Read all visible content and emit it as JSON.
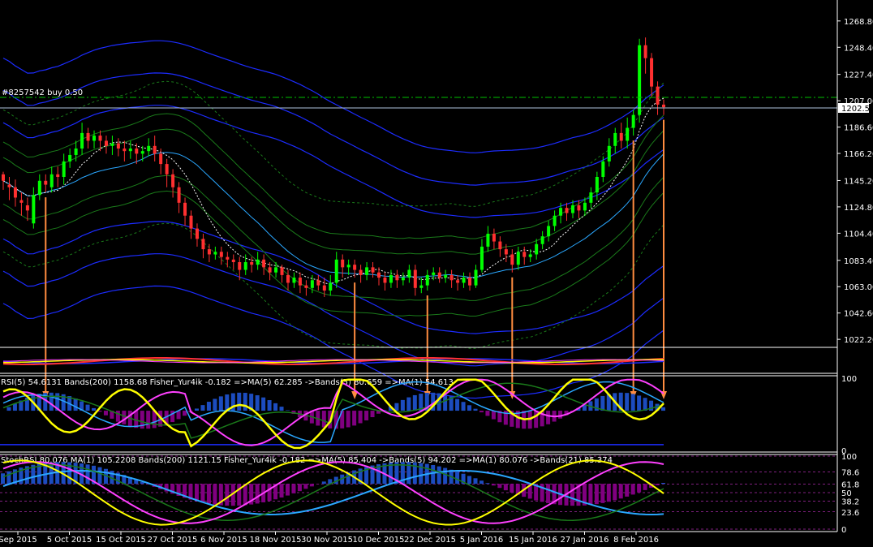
{
  "window": {
    "order_label": "#8257542 buy 0.50",
    "current_price": "1202.53"
  },
  "colors": {
    "background": "#000000",
    "bull_candle": "#00ff00",
    "bear_candle": "#ff3030",
    "arrow_orange": "#ff8c40",
    "band_blue": "#1c2cff",
    "band_cyan": "#2aa7ff",
    "band_green": "#1a7a1a",
    "yellow": "#ffff00",
    "magenta": "#ff40ff",
    "purple": "#800080",
    "grid_white": "#ffffff"
  },
  "chart_data": {
    "type": "line",
    "price_axis": {
      "ticks": [
        "1268.80",
        "1248.40",
        "1227.40",
        "1207.00",
        "1186.60",
        "1166.20",
        "1145.20",
        "1124.80",
        "1104.40",
        "1083.40",
        "1063.00",
        "1042.60",
        "1022.20"
      ],
      "ylim": [
        1016,
        1280
      ]
    },
    "x_ticks": [
      "Sep 2015",
      "5 Oct 2015",
      "15 Oct 2015",
      "27 Oct 2015",
      "6 Nov 2015",
      "18 Nov 2015",
      "30 Nov 2015",
      "10 Dec 2015",
      "22 Dec 2015",
      "5 Jan 2016",
      "15 Jan 2016",
      "27 Jan 2016",
      "8 Feb 2016"
    ],
    "candles": [
      [
        1150,
        1145,
        1138,
        1152
      ],
      [
        1142,
        1140,
        1130,
        1148
      ],
      [
        1140,
        1132,
        1125,
        1146
      ],
      [
        1130,
        1128,
        1118,
        1136
      ],
      [
        1126,
        1122,
        1114,
        1132
      ],
      [
        1112,
        1134,
        1108,
        1140
      ],
      [
        1134,
        1145,
        1130,
        1150
      ],
      [
        1145,
        1142,
        1136,
        1150
      ],
      [
        1140,
        1150,
        1136,
        1156
      ],
      [
        1150,
        1148,
        1140,
        1156
      ],
      [
        1148,
        1160,
        1142,
        1166
      ],
      [
        1160,
        1165,
        1155,
        1170
      ],
      [
        1165,
        1170,
        1160,
        1176
      ],
      [
        1170,
        1182,
        1165,
        1190
      ],
      [
        1182,
        1176,
        1170,
        1186
      ],
      [
        1176,
        1180,
        1170,
        1184
      ],
      [
        1180,
        1176,
        1168,
        1184
      ],
      [
        1176,
        1172,
        1166,
        1180
      ],
      [
        1172,
        1174,
        1165,
        1180
      ],
      [
        1174,
        1170,
        1164,
        1178
      ],
      [
        1170,
        1168,
        1160,
        1176
      ],
      [
        1168,
        1170,
        1162,
        1176
      ],
      [
        1170,
        1166,
        1158,
        1174
      ],
      [
        1166,
        1168,
        1160,
        1172
      ],
      [
        1168,
        1172,
        1164,
        1178
      ],
      [
        1172,
        1166,
        1160,
        1180
      ],
      [
        1166,
        1158,
        1150,
        1170
      ],
      [
        1158,
        1150,
        1140,
        1162
      ],
      [
        1150,
        1140,
        1132,
        1154
      ],
      [
        1140,
        1128,
        1120,
        1144
      ],
      [
        1128,
        1118,
        1110,
        1132
      ],
      [
        1118,
        1108,
        1100,
        1122
      ],
      [
        1108,
        1100,
        1094,
        1112
      ],
      [
        1100,
        1092,
        1085,
        1104
      ],
      [
        1092,
        1088,
        1082,
        1096
      ],
      [
        1088,
        1090,
        1084,
        1094
      ],
      [
        1090,
        1086,
        1080,
        1094
      ],
      [
        1086,
        1084,
        1078,
        1090
      ],
      [
        1084,
        1082,
        1076,
        1088
      ],
      [
        1082,
        1076,
        1068,
        1086
      ],
      [
        1076,
        1082,
        1072,
        1088
      ],
      [
        1082,
        1080,
        1074,
        1086
      ],
      [
        1080,
        1084,
        1076,
        1090
      ],
      [
        1084,
        1078,
        1072,
        1088
      ],
      [
        1078,
        1074,
        1068,
        1082
      ],
      [
        1074,
        1078,
        1070,
        1082
      ],
      [
        1078,
        1072,
        1066,
        1080
      ],
      [
        1072,
        1066,
        1060,
        1076
      ],
      [
        1066,
        1070,
        1062,
        1074
      ],
      [
        1070,
        1064,
        1058,
        1074
      ],
      [
        1064,
        1062,
        1056,
        1068
      ],
      [
        1062,
        1068,
        1058,
        1072
      ],
      [
        1068,
        1064,
        1060,
        1072
      ],
      [
        1064,
        1060,
        1055,
        1070
      ],
      [
        1060,
        1066,
        1056,
        1072
      ],
      [
        1066,
        1084,
        1062,
        1090
      ],
      [
        1084,
        1078,
        1070,
        1088
      ],
      [
        1078,
        1080,
        1072,
        1084
      ],
      [
        1080,
        1076,
        1070,
        1084
      ],
      [
        1076,
        1072,
        1066,
        1080
      ],
      [
        1072,
        1078,
        1068,
        1082
      ],
      [
        1078,
        1074,
        1070,
        1082
      ],
      [
        1074,
        1070,
        1064,
        1078
      ],
      [
        1070,
        1066,
        1060,
        1074
      ],
      [
        1066,
        1072,
        1062,
        1076
      ],
      [
        1072,
        1068,
        1062,
        1076
      ],
      [
        1068,
        1070,
        1064,
        1074
      ],
      [
        1070,
        1076,
        1066,
        1080
      ],
      [
        1076,
        1062,
        1056,
        1080
      ],
      [
        1062,
        1064,
        1058,
        1070
      ],
      [
        1064,
        1072,
        1060,
        1076
      ],
      [
        1072,
        1074,
        1068,
        1078
      ],
      [
        1074,
        1070,
        1066,
        1078
      ],
      [
        1070,
        1072,
        1066,
        1076
      ],
      [
        1072,
        1068,
        1062,
        1076
      ],
      [
        1068,
        1066,
        1060,
        1072
      ],
      [
        1066,
        1070,
        1062,
        1074
      ],
      [
        1070,
        1064,
        1060,
        1074
      ],
      [
        1064,
        1076,
        1062,
        1080
      ],
      [
        1076,
        1094,
        1074,
        1100
      ],
      [
        1094,
        1104,
        1090,
        1110
      ],
      [
        1104,
        1098,
        1092,
        1108
      ],
      [
        1098,
        1092,
        1086,
        1102
      ],
      [
        1092,
        1088,
        1082,
        1096
      ],
      [
        1088,
        1080,
        1074,
        1092
      ],
      [
        1080,
        1090,
        1076,
        1094
      ],
      [
        1090,
        1086,
        1080,
        1094
      ],
      [
        1086,
        1088,
        1082,
        1092
      ],
      [
        1088,
        1096,
        1084,
        1100
      ],
      [
        1096,
        1102,
        1092,
        1106
      ],
      [
        1102,
        1110,
        1098,
        1114
      ],
      [
        1110,
        1118,
        1106,
        1122
      ],
      [
        1118,
        1124,
        1112,
        1128
      ],
      [
        1124,
        1120,
        1114,
        1128
      ],
      [
        1120,
        1126,
        1116,
        1130
      ],
      [
        1126,
        1122,
        1116,
        1130
      ],
      [
        1122,
        1128,
        1118,
        1132
      ],
      [
        1128,
        1136,
        1124,
        1140
      ],
      [
        1136,
        1148,
        1130,
        1152
      ],
      [
        1148,
        1160,
        1144,
        1164
      ],
      [
        1160,
        1172,
        1156,
        1178
      ],
      [
        1172,
        1182,
        1166,
        1186
      ],
      [
        1182,
        1176,
        1170,
        1190
      ],
      [
        1176,
        1186,
        1170,
        1194
      ],
      [
        1186,
        1196,
        1180,
        1200
      ],
      [
        1196,
        1250,
        1190,
        1255
      ],
      [
        1250,
        1240,
        1228,
        1256
      ],
      [
        1240,
        1218,
        1210,
        1244
      ],
      [
        1218,
        1204,
        1196,
        1222
      ],
      [
        1204,
        1202,
        1196,
        1208
      ]
    ],
    "rsi_panel": {
      "title": "RSI(5) 54.6131  Bands(200) 1158.68  Fisher_Yur4ik -0.182  =>MA(5) 62.285  ->Bands(5) 80.659  =>MA(1) 54.613",
      "ticks": [
        "100",
        "0"
      ]
    },
    "stoch_panel": {
      "title": "StochRSI 80.076  MA(1) 105.2208  Bands(200) 1121.15  Fisher_Yur4ik -0.182  =>MA(5) 85.404  ->Bands(5) 94.202  =>MA(1) 80.076  ->Bands(21) 85.374",
      "ticks": [
        "100",
        "78.6",
        "61.8",
        "50",
        "38.2",
        "23.6",
        "0"
      ]
    }
  }
}
